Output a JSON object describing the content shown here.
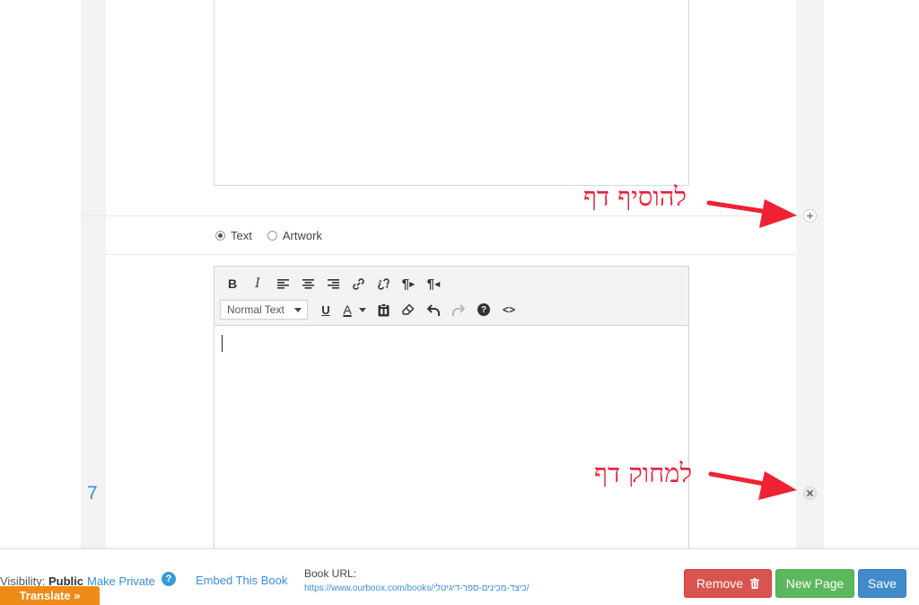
{
  "radio_options": [
    {
      "label": "Text",
      "checked": true
    },
    {
      "label": "Artwork",
      "checked": false
    }
  ],
  "toolbar": {
    "format_select": "Normal Text",
    "icons": [
      "bold-icon",
      "italic-icon",
      "align-left-icon",
      "align-center-icon",
      "align-right-icon",
      "link-icon",
      "unlink-icon",
      "paragraph-ltr-icon",
      "paragraph-rtl-icon",
      "underline-icon",
      "font-color-icon",
      "paste-icon",
      "eraser-icon",
      "undo-icon",
      "redo-icon",
      "help-icon",
      "code-icon"
    ],
    "bold": "B",
    "italic": "I",
    "underline": "U",
    "font_color": "A"
  },
  "page_number": "7",
  "annotations": {
    "add_page": "להוסיף דף",
    "delete_page": "למחוק דף",
    "color": "#e8213a"
  },
  "footer": {
    "visibility_label": "Visibility:",
    "visibility_value": "Public",
    "make_private": "Make Private",
    "help": "?",
    "embed": "Embed This Book",
    "book_url_label": "Book URL:",
    "book_url": "https://www.ourboox.com/books/כיצד-מכינים-ספר-דיגיטלי/",
    "remove": "Remove",
    "new_page": "New Page",
    "save": "Save"
  },
  "translate": "Translate »",
  "colors": {
    "accent": "#3a8ed8",
    "remove": "#d9534f",
    "new_page": "#5cb85c",
    "save": "#428bca",
    "translate": "#f08a16"
  }
}
